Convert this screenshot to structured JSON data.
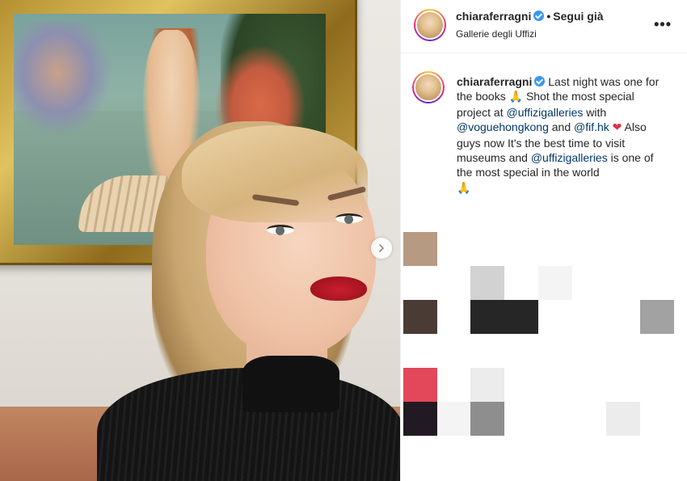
{
  "post": {
    "username": "chiaraferragni",
    "follow_label": "Segui già",
    "location": "Gallerie degli Uffizi",
    "more_label": "•••",
    "caption": {
      "username": "chiaraferragni",
      "text_1": "Last night was one for the books",
      "emoji_pray": "🙏",
      "text_2": "Shot the most special project at",
      "mention_1": "@uffizigalleries",
      "text_3": "with",
      "mention_2": "@voguehongkong",
      "text_4": "and",
      "mention_3": "@fif.hk",
      "emoji_heart": "❤",
      "text_5": "Also guys now It's the best time to visit museums and",
      "mention_4": "@uffizigalleries",
      "text_6": "is one of the most special in the world"
    }
  },
  "colors": {
    "verified": "#3897f0",
    "mention": "#00376b",
    "heart": "#e03046"
  },
  "icons": {
    "verified": "verified-badge-icon",
    "next": "chevron-right-icon",
    "more": "more-options-icon"
  }
}
